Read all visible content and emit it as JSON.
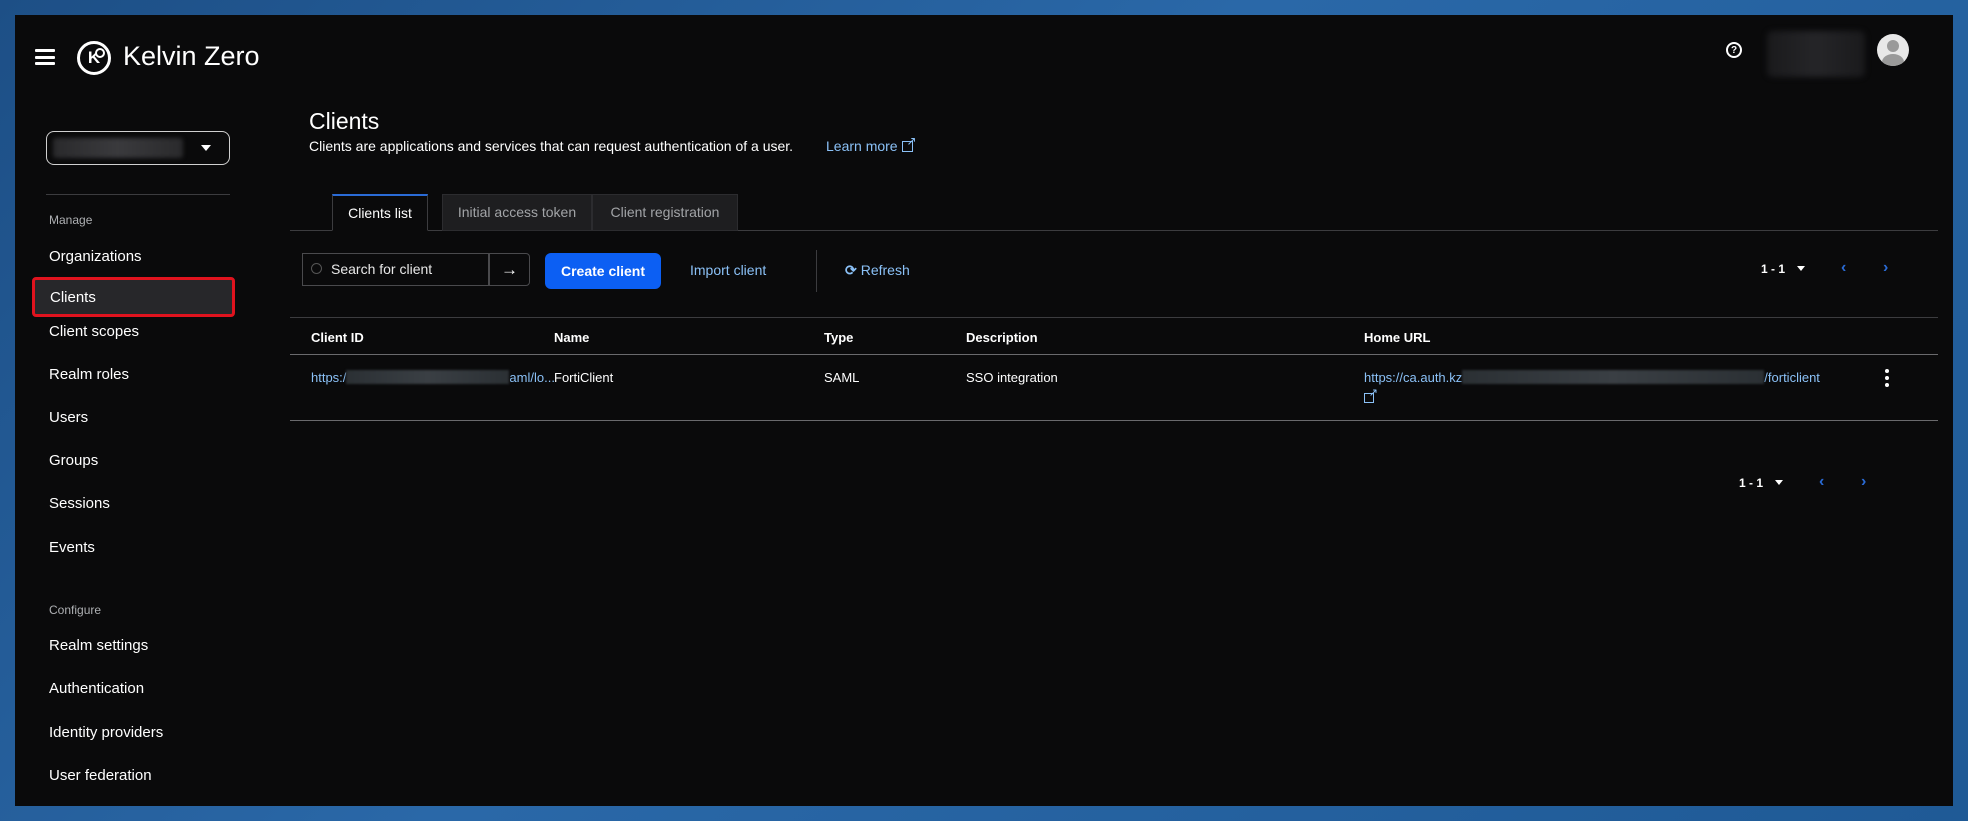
{
  "header": {
    "brand": "Kelvin Zero",
    "logo_icon": "kelvin-zero-logo",
    "help_symbol": "?"
  },
  "sidebar": {
    "section_manage": "Manage",
    "manage_items": [
      {
        "label": "Organizations",
        "active": false
      },
      {
        "label": "Clients",
        "active": true
      },
      {
        "label": "Client scopes",
        "active": false
      },
      {
        "label": "Realm roles",
        "active": false
      },
      {
        "label": "Users",
        "active": false
      },
      {
        "label": "Groups",
        "active": false
      },
      {
        "label": "Sessions",
        "active": false
      },
      {
        "label": "Events",
        "active": false
      }
    ],
    "section_configure": "Configure",
    "configure_items": [
      {
        "label": "Realm settings"
      },
      {
        "label": "Authentication"
      },
      {
        "label": "Identity providers"
      },
      {
        "label": "User federation"
      }
    ]
  },
  "main": {
    "title": "Clients",
    "description": "Clients are applications and services that can request authentication of a user.",
    "learn_more": "Learn more",
    "tabs": [
      {
        "label": "Clients list",
        "active": true
      },
      {
        "label": "Initial access token",
        "active": false
      },
      {
        "label": "Client registration",
        "active": false
      }
    ],
    "toolbar": {
      "search_placeholder": "Search for client",
      "search_go_symbol": "→",
      "create_label": "Create client",
      "import_label": "Import client",
      "refresh_label": "Refresh",
      "refresh_symbol": "⟳"
    },
    "pagination": {
      "range": "1 - 1",
      "prev_symbol": "‹",
      "next_symbol": "›"
    },
    "table": {
      "columns": [
        "Client ID",
        "Name",
        "Type",
        "Description",
        "Home URL"
      ],
      "rows": [
        {
          "client_id_start": "https:/",
          "client_id_end": "aml/lo...",
          "name": "FortiClient",
          "type": "SAML",
          "description": "SSO integration",
          "home_url_start": "https://ca.auth.kz",
          "home_url_end": "/forticlient"
        }
      ]
    }
  },
  "colors": {
    "accent": "#0c5ff3",
    "link": "#8bc1f7",
    "highlight": "#e0131e",
    "background": "#0a0a0b"
  }
}
